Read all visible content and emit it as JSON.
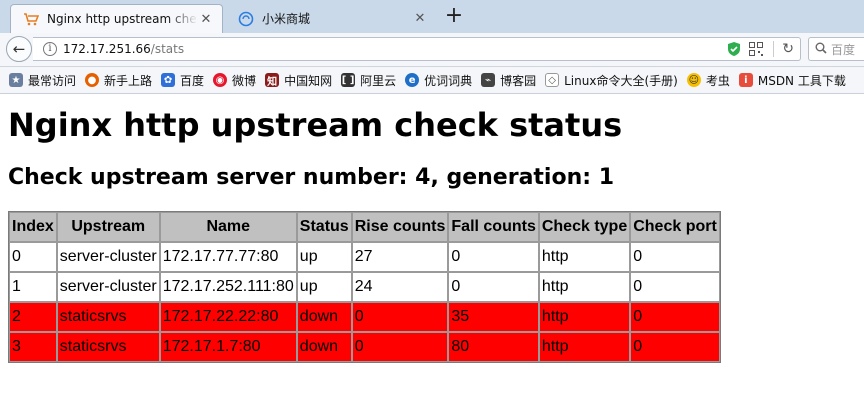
{
  "browser": {
    "tabs": [
      {
        "title": "Nginx http upstream check status",
        "favicon": "nginx-favicon",
        "active": true
      },
      {
        "title": "小米商城",
        "favicon": "mi-favicon",
        "active": false
      }
    ],
    "new_tab_label": "+",
    "close_label": "✕",
    "back_label": "←",
    "url": {
      "host": "172.17.251.66",
      "path": "/stats"
    },
    "search_placeholder": "百度",
    "bookmarks": [
      {
        "label": "最常访问",
        "icon": "star-bookmark-icon",
        "color": "#6a7fa0"
      },
      {
        "label": "新手上路",
        "icon": "firefox-icon",
        "color": "#e66000"
      },
      {
        "label": "百度",
        "icon": "baidu-paw-icon",
        "color": "#2f6fd8"
      },
      {
        "label": "微博",
        "icon": "weibo-icon",
        "color": "#e6162d"
      },
      {
        "label": "中国知网",
        "icon": "cnki-icon",
        "color": "#8a1c1c"
      },
      {
        "label": "阿里云",
        "icon": "aliyun-icon",
        "color": "#333333"
      },
      {
        "label": "优词词典",
        "icon": "dictionary-icon",
        "color": "#1f6fc9"
      },
      {
        "label": "博客园",
        "icon": "cnblogs-icon",
        "color": "#444444"
      },
      {
        "label": "Linux命令大全(手册)",
        "icon": "linux-cmd-icon",
        "color": "#555555"
      },
      {
        "label": "考虫",
        "icon": "kaochong-icon",
        "color": "#f6c000"
      },
      {
        "label": "MSDN 工具下载",
        "icon": "msdn-icon",
        "color": "#e74c3c"
      }
    ]
  },
  "page": {
    "title": "Nginx http upstream check status",
    "subtitle": "Check upstream server number: 4, generation: 1",
    "columns": [
      "Index",
      "Upstream",
      "Name",
      "Status",
      "Rise counts",
      "Fall counts",
      "Check type",
      "Check port"
    ],
    "rows": [
      {
        "index": "0",
        "upstream": "server-cluster",
        "name": "172.17.77.77:80",
        "status": "up",
        "rise": "27",
        "fall": "0",
        "type": "http",
        "port": "0"
      },
      {
        "index": "1",
        "upstream": "server-cluster",
        "name": "172.17.252.111:80",
        "status": "up",
        "rise": "24",
        "fall": "0",
        "type": "http",
        "port": "0"
      },
      {
        "index": "2",
        "upstream": "staticsrvs",
        "name": "172.17.22.22:80",
        "status": "down",
        "rise": "0",
        "fall": "35",
        "type": "http",
        "port": "0"
      },
      {
        "index": "3",
        "upstream": "staticsrvs",
        "name": "172.17.1.7:80",
        "status": "down",
        "rise": "0",
        "fall": "80",
        "type": "http",
        "port": "0"
      }
    ],
    "colors": {
      "down_row": "#ff0000",
      "header_bg": "#c0c0c0"
    }
  }
}
